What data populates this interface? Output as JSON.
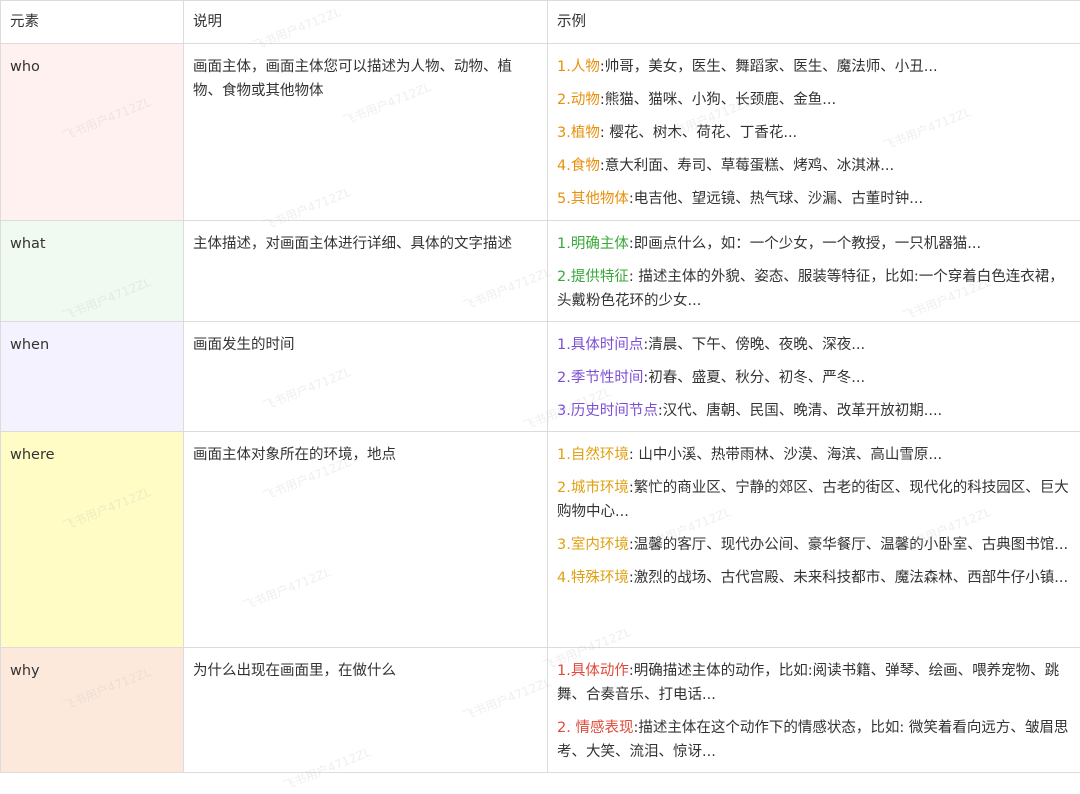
{
  "table": {
    "headers": [
      "元素",
      "说明",
      "示例"
    ],
    "rows": [
      {
        "element": "who",
        "bg": "#fff1f0",
        "accent": "#e8900c",
        "description": "画面主体，画面主体您可以描述为人物、动物、植物、食物或其他物体",
        "examples": [
          {
            "label": "1.人物",
            "text": ":帅哥，美女，医生、舞蹈家、医生、魔法师、小丑..."
          },
          {
            "label": "2.动物",
            "text": ":熊猫、猫咪、小狗、长颈鹿、金鱼..."
          },
          {
            "label": "3.植物",
            "text": ": 樱花、树木、荷花、丁香花..."
          },
          {
            "label": "4.食物",
            "text": ":意大利面、寿司、草莓蛋糕、烤鸡、冰淇淋..."
          },
          {
            "label": "5.其他物体",
            "text": ":电吉他、望远镜、热气球、沙漏、古董时钟..."
          }
        ]
      },
      {
        "element": "what",
        "bg": "#f0faf0",
        "accent": "#3aa83a",
        "description": "主体描述，对画面主体进行详细、具体的文字描述",
        "examples": [
          {
            "label": "1.明确主体",
            "text": ":即画点什么，如：一个少女，一个教授，一只机器猫..."
          },
          {
            "label": "2.提供特征",
            "text": ": 描述主体的外貌、姿态、服装等特征，比如:一个穿着白色连衣裙，头戴粉色花环的少女..."
          }
        ]
      },
      {
        "element": "when",
        "bg": "#f5f2ff",
        "accent": "#7a4fd4",
        "description": "画面发生的时间",
        "examples": [
          {
            "label": "1.具体时间点",
            "text": ":清晨、下午、傍晚、夜晚、深夜..."
          },
          {
            "label": "2.季节性时间",
            "text": ":初春、盛夏、秋分、初冬、严冬..."
          },
          {
            "label": "3.历史时间节点",
            "text": ":汉代、唐朝、民国、晚清、改革开放初期...."
          }
        ]
      },
      {
        "element": "where",
        "bg": "#fffcc6",
        "accent": "#e0a010",
        "description": "画面主体对象所在的环境，地点",
        "examples": [
          {
            "label": "1.自然环境",
            "text": ": 山中小溪、热带雨林、沙漠、海滨、高山雪原..."
          },
          {
            "label": "2.城市环境",
            "text": ":繁忙的商业区、宁静的郊区、古老的街区、现代化的科技园区、巨大购物中心..."
          },
          {
            "label": "3.室内环境",
            "text": ":温馨的客厅、现代办公间、豪华餐厅、温馨的小卧室、古典图书馆..."
          },
          {
            "label": "4.特殊环境",
            "text": ":激烈的战场、古代宫殿、未来科技都市、魔法森林、西部牛仔小镇..."
          }
        ]
      },
      {
        "element": "why",
        "bg": "#fde9dc",
        "accent": "#e04a3a",
        "description": "为什么出现在画面里，在做什么",
        "examples": [
          {
            "label": "1.具体动作",
            "text": ":明确描述主体的动作，比如:阅读书籍、弹琴、绘画、喂养宠物、跳舞、合奏音乐、打电话..."
          },
          {
            "label": "2. 情感表现",
            "text": ":描述主体在这个动作下的情感状态，比如: 微笑着看向远方、皱眉思考、大笑、流泪、惊讶..."
          }
        ]
      }
    ]
  },
  "watermark": "飞书用户4712ZL"
}
